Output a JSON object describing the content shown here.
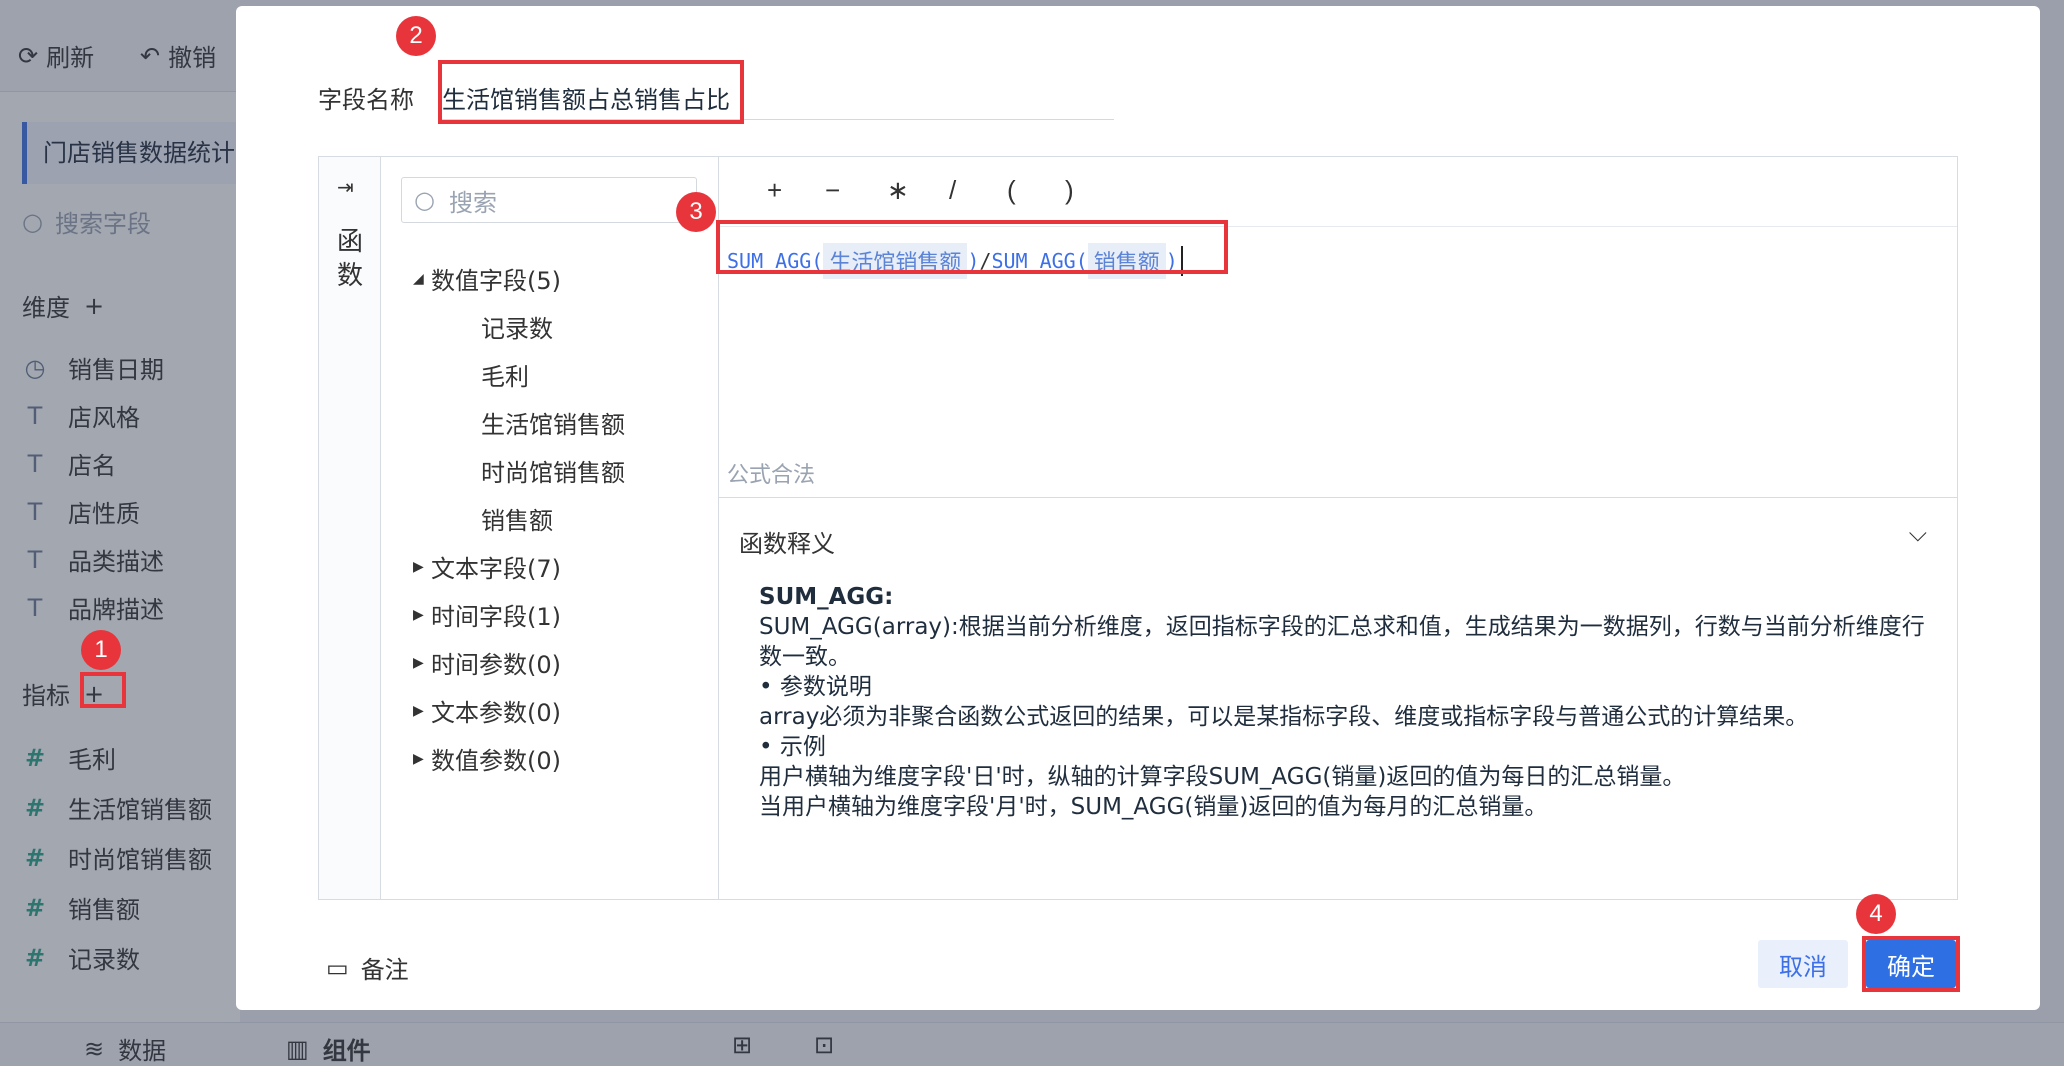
{
  "toolbar": {
    "refresh": "刷新",
    "undo": "撤销"
  },
  "sidebar": {
    "dataset_title": "门店销售数据统计",
    "search_placeholder": "搜索字段",
    "dimension_label": "维度",
    "dimensions": [
      {
        "icon": "clock-icon",
        "label": "销售日期"
      },
      {
        "icon": "text-field-icon",
        "label": "店风格"
      },
      {
        "icon": "text-field-icon",
        "label": "店名"
      },
      {
        "icon": "text-field-icon",
        "label": "店性质"
      },
      {
        "icon": "text-field-icon",
        "label": "品类描述"
      },
      {
        "icon": "text-field-icon",
        "label": "品牌描述"
      }
    ],
    "measure_label": "指标",
    "measures": [
      {
        "icon": "number-field-icon",
        "label": "毛利"
      },
      {
        "icon": "number-field-icon",
        "label": "生活馆销售额"
      },
      {
        "icon": "number-field-icon",
        "label": "时尚馆销售额"
      },
      {
        "icon": "number-field-icon",
        "label": "销售额"
      },
      {
        "icon": "count-field-icon",
        "label": "记录数"
      }
    ]
  },
  "bottombar": {
    "data_tab": "数据",
    "component_tab": "组件"
  },
  "dialog": {
    "field_name_label": "字段名称",
    "field_name_value": "生活馆销售额占总销售占比",
    "function_tab": "函数",
    "tree_search_placeholder": "搜索",
    "tree": {
      "numeric_group": "数值字段(5)",
      "numeric_items": [
        "记录数",
        "毛利",
        "生活馆销售额",
        "时尚馆销售额",
        "销售额"
      ],
      "collapsed_groups": [
        "文本字段(7)",
        "时间字段(1)",
        "时间参数(0)",
        "文本参数(0)",
        "数值参数(0)"
      ]
    },
    "operators": [
      "+",
      "−",
      "∗",
      "/",
      "(",
      ")"
    ],
    "formula": {
      "fn1": "SUM_AGG(",
      "arg1": "生活馆销售额",
      "close1": ")",
      "slash": "/",
      "fn2": "SUM_AGG(",
      "arg2": "销售额",
      "close2": ")"
    },
    "validation": "公式合法",
    "explain": {
      "title": "函数释义",
      "fn_name": "SUM_AGG:",
      "lines": [
        "SUM_AGG(array):根据当前分析维度，返回指标字段的汇总求和值，生成结果为一数据列，行数与当前分析维度行数一致。",
        "• 参数说明",
        "array必须为非聚合函数公式返回的结果，可以是某指标字段、维度或指标字段与普通公式的计算结果。",
        "• 示例",
        "用户横轴为维度字段'日'时，纵轴的计算字段SUM_AGG(销量)返回的值为每日的汇总销量。",
        "当用户横轴为维度字段'月'时，SUM_AGG(销量)返回的值为每月的汇总销量。"
      ]
    },
    "note": "备注",
    "cancel": "取消",
    "confirm": "确定"
  },
  "badges": [
    "1",
    "2",
    "3",
    "4"
  ],
  "colors": {
    "accent": "#2f6fe4",
    "highlight": "#e8353b"
  }
}
